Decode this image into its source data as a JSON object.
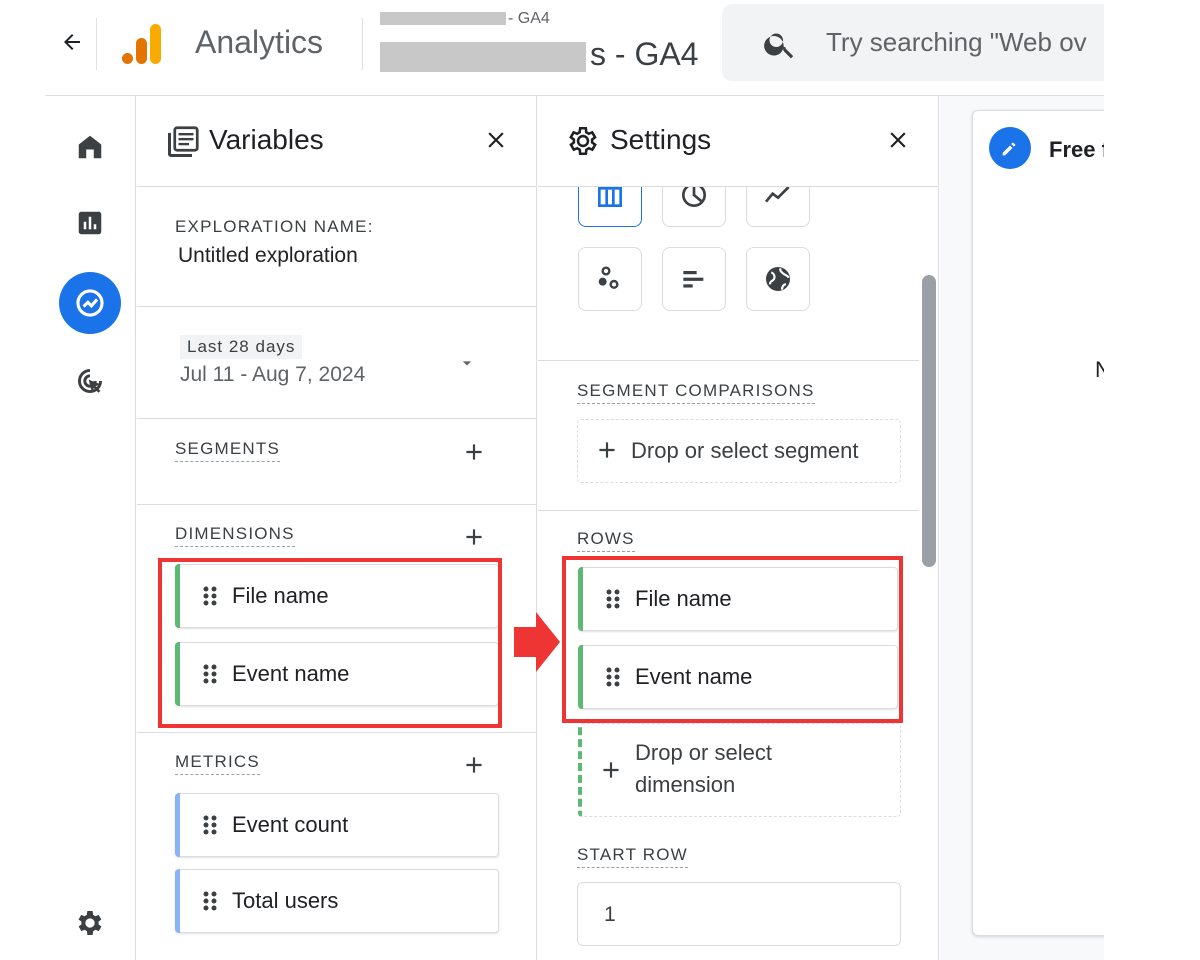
{
  "header": {
    "app_title": "Analytics",
    "account_small_suffix": "- GA4",
    "account_big_suffix": "s - GA4",
    "search_placeholder": "Try searching \"Web ov",
    "colors": {
      "logo_dark": "#e37400",
      "logo_light": "#f9ab00"
    }
  },
  "rail": {
    "items": [
      {
        "name": "home-icon"
      },
      {
        "name": "reports-icon"
      },
      {
        "name": "explore-icon",
        "active": true
      },
      {
        "name": "advertising-icon"
      },
      {
        "name": "settings-gear-icon"
      }
    ]
  },
  "variables": {
    "title": "Variables",
    "exploration_name_label": "EXPLORATION NAME:",
    "exploration_name_value": "Untitled exploration",
    "date_badge": "Last 28 days",
    "date_range": "Jul 11 - Aug 7, 2024",
    "segments_label": "SEGMENTS",
    "dimensions_label": "DIMENSIONS",
    "dimensions": [
      "File name",
      "Event name"
    ],
    "metrics_label": "METRICS",
    "metrics": [
      "Event count",
      "Total users"
    ]
  },
  "settings": {
    "title": "Settings",
    "segment_comparisons_label": "SEGMENT COMPARISONS",
    "drop_segment": "Drop or select segment",
    "rows_label": "ROWS",
    "rows": [
      "File name",
      "Event name"
    ],
    "drop_dimension_line1": "Drop or select",
    "drop_dimension_line2": "dimension",
    "start_row_label": "START ROW",
    "start_row_value": "1"
  },
  "canvas": {
    "tab_label": "Free f",
    "body_text": "N"
  },
  "colors": {
    "accent": "#1a73e8",
    "dimension_bar": "#5bb974",
    "metric_bar": "#8ab4f8",
    "highlight": "#ef3434"
  }
}
